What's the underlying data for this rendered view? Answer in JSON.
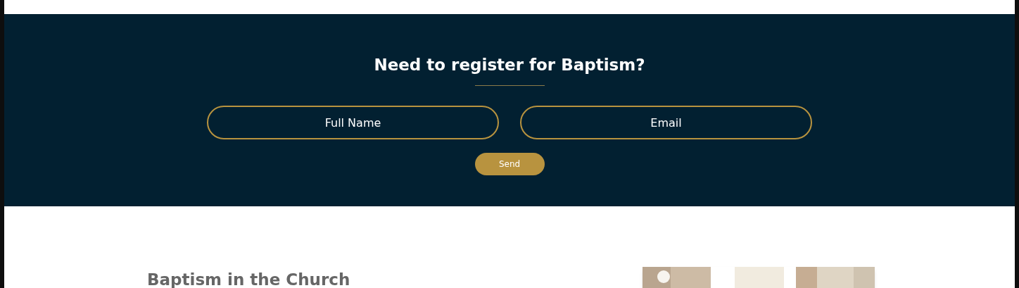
{
  "register": {
    "heading": "Need to register for Baptism?",
    "fields": [
      {
        "placeholder": "Full Name"
      },
      {
        "placeholder": "Email"
      }
    ],
    "button": "Send"
  },
  "intro": {
    "heading": "Baptism in the Church"
  }
}
